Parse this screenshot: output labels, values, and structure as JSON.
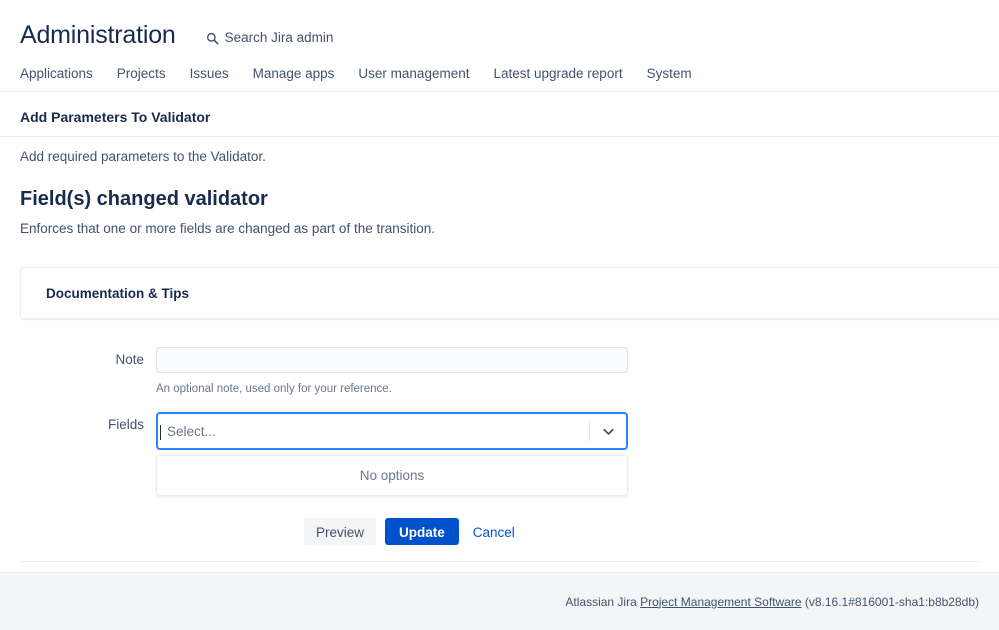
{
  "header": {
    "title": "Administration",
    "search_label": "Search Jira admin",
    "search_icon": "search-icon"
  },
  "nav": {
    "items": [
      {
        "label": "Applications"
      },
      {
        "label": "Projects"
      },
      {
        "label": "Issues"
      },
      {
        "label": "Manage apps"
      },
      {
        "label": "User management"
      },
      {
        "label": "Latest upgrade report"
      },
      {
        "label": "System"
      }
    ]
  },
  "page": {
    "section_title": "Add Parameters To Validator",
    "section_desc": "Add required parameters to the Validator.",
    "validator_title": "Field(s) changed validator",
    "validator_desc": "Enforces that one or more fields are changed as part of the transition."
  },
  "docs_panel": {
    "label": "Documentation & Tips"
  },
  "form": {
    "note": {
      "label": "Note",
      "value": "",
      "placeholder": "",
      "hint": "An optional note, used only for your reference."
    },
    "fields": {
      "label": "Fields",
      "placeholder": "Select...",
      "caret_icon": "text-caret-icon",
      "arrow_icon": "chevron-down-icon",
      "menu": {
        "empty_label": "No options"
      }
    }
  },
  "buttons": {
    "preview": "Preview",
    "update": "Update",
    "cancel": "Cancel"
  },
  "footer": {
    "prefix": "Atlassian Jira ",
    "link": "Project Management Software",
    "suffix": " (v8.16.1#816001-sha1:b8b28db)"
  },
  "colors": {
    "brand_blue": "#0052CC",
    "focus_blue": "#2684FF",
    "text": "#172B4D",
    "subtle_text": "#42526E",
    "placeholder": "#6B778C",
    "border": "#DFE1E6",
    "divider": "#EBECF0",
    "footer_bg": "#F4F5F7"
  }
}
